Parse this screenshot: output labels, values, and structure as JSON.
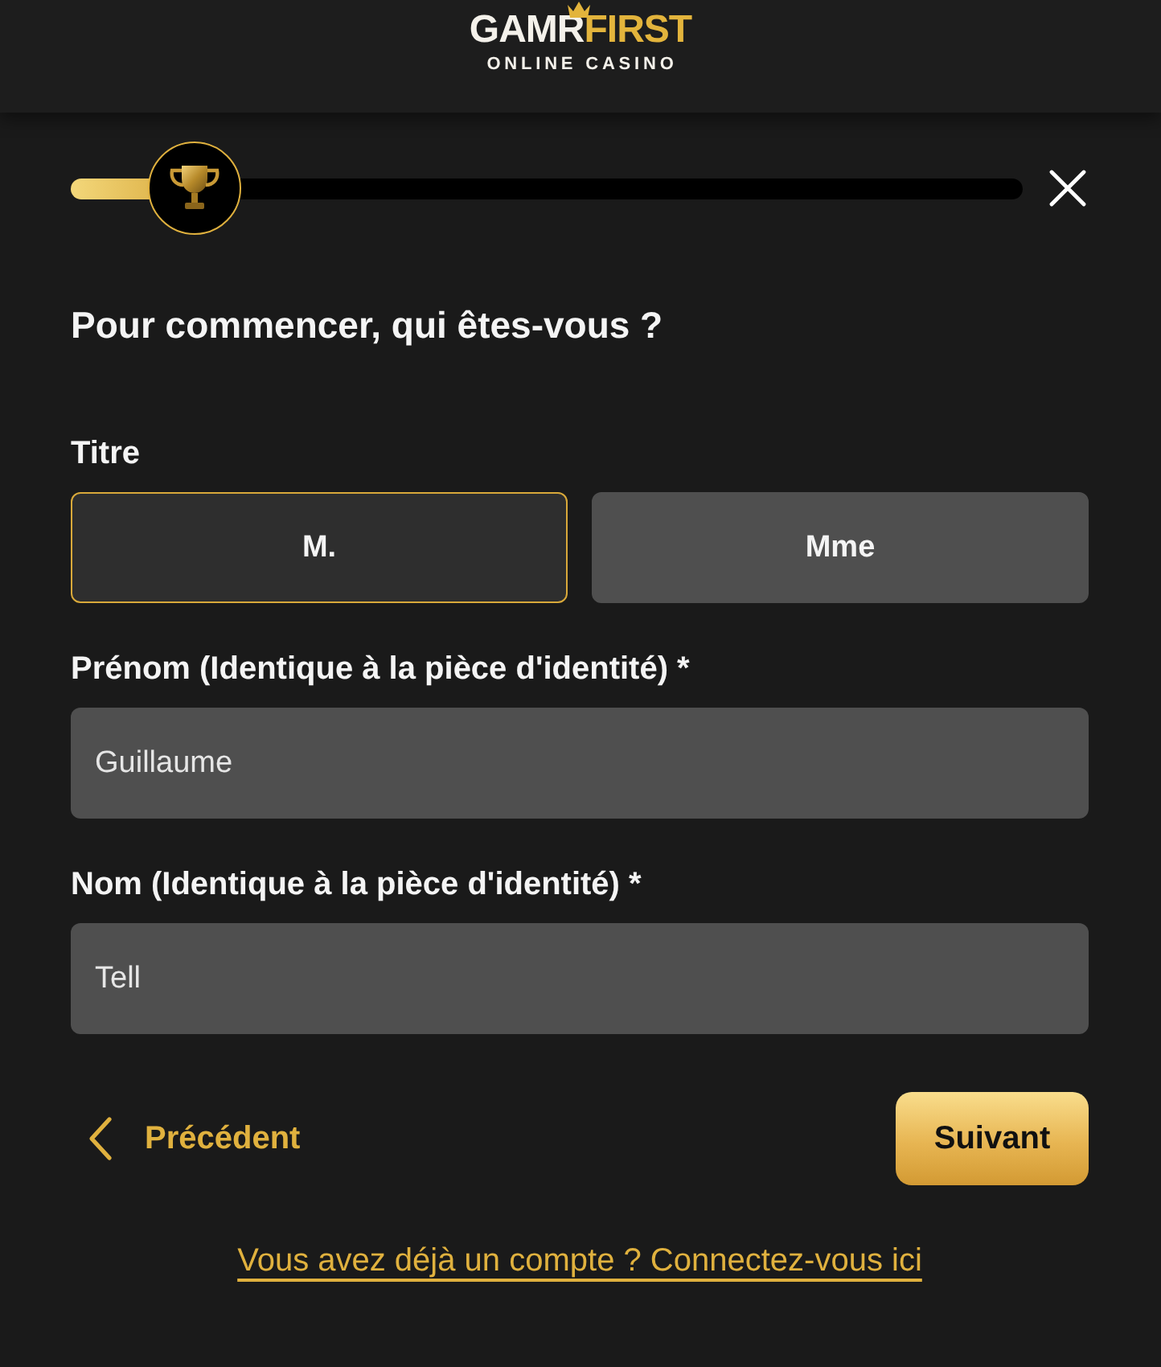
{
  "header": {
    "logo": {
      "primary": "GAMR",
      "accent": "FIRST",
      "tagline": "ONLINE CASINO"
    }
  },
  "progress": {
    "level": 0.13
  },
  "title": "Pour commencer, qui êtes-vous ?",
  "form": {
    "title_field": {
      "label": "Titre",
      "options": [
        {
          "label": "M.",
          "selected": true
        },
        {
          "label": "Mme",
          "selected": false
        }
      ]
    },
    "fields": [
      {
        "label": "Prénom (Identique à la pièce d'identité) *",
        "value": "Guillaume"
      },
      {
        "label": "Nom (Identique à la pièce d'identité) *",
        "value": "Tell"
      }
    ]
  },
  "nav": {
    "previous": "Précédent",
    "next": "Suivant"
  },
  "login_link": "Vous avez déjà un compte ? Connectez-vous ici"
}
